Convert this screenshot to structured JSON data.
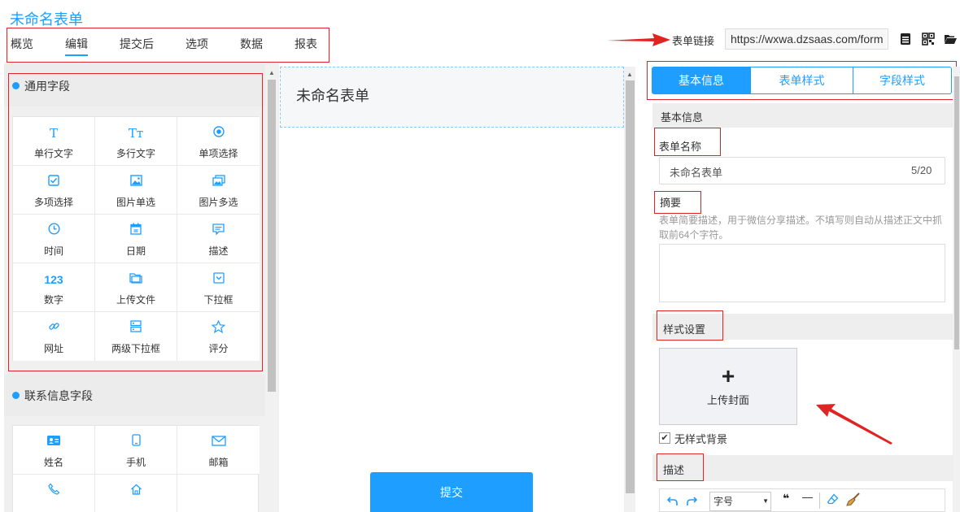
{
  "app": {
    "title": "未命名表单"
  },
  "nav": {
    "tabs": [
      "概览",
      "编辑",
      "提交后",
      "选项",
      "数据",
      "报表"
    ],
    "active": "编辑"
  },
  "header": {
    "link_label": "表单链接",
    "link_url": "https://wxwa.dzsaas.com/form"
  },
  "left": {
    "common": {
      "title": "通用字段",
      "items": [
        {
          "icon": "text-icon",
          "label": "单行文字"
        },
        {
          "icon": "multiline-text-icon",
          "label": "多行文字"
        },
        {
          "icon": "radio-icon",
          "label": "单项选择"
        },
        {
          "icon": "checkbox-icon",
          "label": "多项选择"
        },
        {
          "icon": "image-icon",
          "label": "图片单选"
        },
        {
          "icon": "images-icon",
          "label": "图片多选"
        },
        {
          "icon": "clock-icon",
          "label": "时间"
        },
        {
          "icon": "calendar-icon",
          "label": "日期"
        },
        {
          "icon": "comment-icon",
          "label": "描述"
        },
        {
          "icon": "number-icon",
          "label": "数字"
        },
        {
          "icon": "folder-icon",
          "label": "上传文件"
        },
        {
          "icon": "dropdown-icon",
          "label": "下拉框"
        },
        {
          "icon": "link-icon",
          "label": "网址"
        },
        {
          "icon": "cascade-dropdown-icon",
          "label": "两级下拉框"
        },
        {
          "icon": "star-icon",
          "label": "评分"
        }
      ],
      "number_glyph": "123",
      "text_glyph": "T",
      "multitext_glyph": "Tт"
    },
    "contact": {
      "title": "联系信息字段",
      "items": [
        {
          "icon": "id-card-icon",
          "label": "姓名"
        },
        {
          "icon": "mobile-icon",
          "label": "手机"
        },
        {
          "icon": "mail-icon",
          "label": "邮箱"
        },
        {
          "icon": "phone-icon",
          "label": ""
        },
        {
          "icon": "home-icon",
          "label": ""
        }
      ]
    }
  },
  "preview": {
    "title": "未命名表单",
    "submit": "提交"
  },
  "right": {
    "tabs": [
      "基本信息",
      "表单样式",
      "字段样式"
    ],
    "section_basic": "基本信息",
    "form_name_label": "表单名称",
    "form_name_value": "未命名表单",
    "form_name_count": "5/20",
    "summary_label": "摘要",
    "summary_hint": "表单简要描述，用于微信分享描述。不填写则自动从描述正文中抓取前64个字符。",
    "style_section": "样式设置",
    "upload_plus": "+",
    "upload_label": "上传封面",
    "no_bg_label": "无样式背景",
    "no_bg_checked": "✔",
    "desc_section": "描述",
    "font_select": "字号",
    "quote_glyph": "❝",
    "hr_glyph": "—"
  },
  "colors": {
    "accent": "#1e9fff",
    "annotation": "#e02424"
  }
}
